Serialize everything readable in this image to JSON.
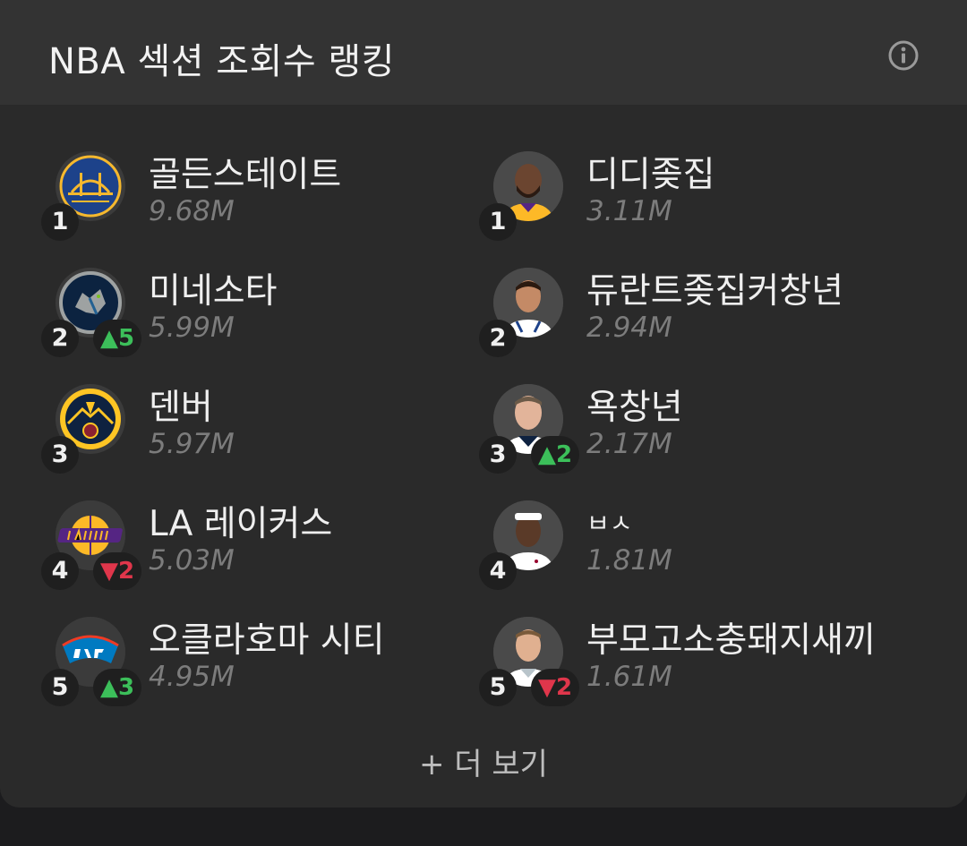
{
  "header": {
    "title": "NBA 섹션 조회수 랭킹",
    "info_icon": "info-icon"
  },
  "teams": [
    {
      "rank": "1",
      "name": "골든스테이트",
      "views": "9.68M",
      "logo": "warriors-logo-icon",
      "change": ""
    },
    {
      "rank": "2",
      "name": "미네소타",
      "views": "5.99M",
      "logo": "timberwolves-logo-icon",
      "change": "▲5",
      "change_dir": "up"
    },
    {
      "rank": "3",
      "name": "덴버",
      "views": "5.97M",
      "logo": "nuggets-logo-icon",
      "change": ""
    },
    {
      "rank": "4",
      "name": "LA 레이커스",
      "views": "5.03M",
      "logo": "lakers-logo-icon",
      "change": "▼2",
      "change_dir": "down"
    },
    {
      "rank": "5",
      "name": "오클라호마 시티",
      "views": "4.95M",
      "logo": "thunder-logo-icon",
      "change": "▲3",
      "change_dir": "up"
    }
  ],
  "players": [
    {
      "rank": "1",
      "name": "디디좆집",
      "views": "3.11M",
      "avatar": "player-avatar-icon",
      "change": ""
    },
    {
      "rank": "2",
      "name": "듀란트좆집커창년",
      "views": "2.94M",
      "avatar": "player-avatar-icon",
      "change": ""
    },
    {
      "rank": "3",
      "name": "욕창년",
      "views": "2.17M",
      "avatar": "player-avatar-icon",
      "change": "▲2",
      "change_dir": "up"
    },
    {
      "rank": "4",
      "name": "ㅂㅅ",
      "views": "1.81M",
      "avatar": "player-avatar-icon",
      "change": ""
    },
    {
      "rank": "5",
      "name": "부모고소충돼지새끼",
      "views": "1.61M",
      "avatar": "player-avatar-icon",
      "change": "▼2",
      "change_dir": "down"
    }
  ],
  "footer": {
    "more_label": "+ 더 보기"
  },
  "colors": {
    "up": "#3cbf5a",
    "down": "#e0364b",
    "background": "#2a2a2a",
    "header": "#333333"
  }
}
